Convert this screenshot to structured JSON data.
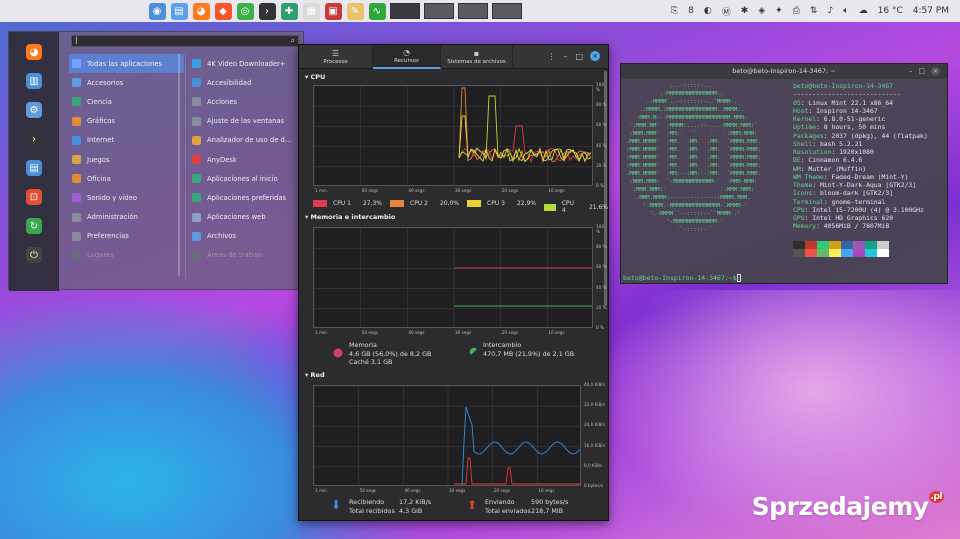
{
  "panel": {
    "launchers": [
      {
        "name": "mint-menu-icon",
        "color": "#4a90d9",
        "glyph": "◉"
      },
      {
        "name": "files-icon",
        "color": "#5fa0e6",
        "glyph": "▤"
      },
      {
        "name": "firefox-icon",
        "color": "#ff7a1a",
        "glyph": "◕"
      },
      {
        "name": "brave-icon",
        "color": "#fb542b",
        "glyph": "◆"
      },
      {
        "name": "chrome-icon",
        "color": "#3bb04b",
        "glyph": "◎"
      },
      {
        "name": "terminal-icon",
        "color": "#333333",
        "glyph": "›"
      },
      {
        "name": "update-icon",
        "color": "#2e9e6e",
        "glyph": "✚"
      },
      {
        "name": "calculator-icon",
        "color": "#d9d9d9",
        "glyph": "▦"
      },
      {
        "name": "screenshot-icon",
        "color": "#c83b3b",
        "glyph": "▣"
      },
      {
        "name": "text-editor-icon",
        "color": "#e8c36a",
        "glyph": "✎"
      },
      {
        "name": "system-monitor-icon",
        "color": "#2fa83a",
        "glyph": "∿"
      }
    ],
    "tray": {
      "badge": "8",
      "temperature": "16 °C",
      "time": "4:57 PM"
    }
  },
  "menu": {
    "search_value": "|",
    "categories": [
      {
        "label": "Todas las aplicaciones",
        "color": "#6fa3ff"
      },
      {
        "label": "Accesorios",
        "color": "#5f9be0"
      },
      {
        "label": "Ciencia",
        "color": "#3aa87a"
      },
      {
        "label": "Gráficos",
        "color": "#e08a3a"
      },
      {
        "label": "Internet",
        "color": "#4a90d9"
      },
      {
        "label": "Juegos",
        "color": "#d9a24a"
      },
      {
        "label": "Oficina",
        "color": "#e08a3a"
      },
      {
        "label": "Sonido y vídeo",
        "color": "#a060d0"
      },
      {
        "label": "Administración",
        "color": "#8a8aa0"
      },
      {
        "label": "Preferencias",
        "color": "#8a8aa0"
      },
      {
        "label": "Lugares",
        "color": "#6a6a80"
      }
    ],
    "apps": [
      {
        "label": "4K Video Downloader+",
        "color": "#3aa0e0"
      },
      {
        "label": "Accesibilidad",
        "color": "#4a90d9"
      },
      {
        "label": "Acciones",
        "color": "#8a8aa0"
      },
      {
        "label": "Ajuste de las ventanas",
        "color": "#8a8aa0"
      },
      {
        "label": "Analizador de uso de d...",
        "color": "#e0a040"
      },
      {
        "label": "AnyDesk",
        "color": "#e04040"
      },
      {
        "label": "Aplicaciones al inicio",
        "color": "#3aa87a"
      },
      {
        "label": "Aplicaciones preferidas",
        "color": "#3aa87a"
      },
      {
        "label": "Aplicaciones web",
        "color": "#8aa0c0"
      },
      {
        "label": "Archivos",
        "color": "#5f9be0"
      },
      {
        "label": "Áreas de trabajo",
        "color": "#6a6a80"
      }
    ],
    "favorites": [
      {
        "name": "firefox-fav-icon",
        "color": "#ff7a1a",
        "glyph": "◕"
      },
      {
        "name": "software-manager-fav-icon",
        "color": "#4a90d9",
        "glyph": "▥"
      },
      {
        "name": "settings-fav-icon",
        "color": "#5f9be0",
        "glyph": "⚙"
      },
      {
        "name": "terminal-fav-icon",
        "color": "#333333",
        "glyph": "›"
      },
      {
        "name": "files-fav-icon",
        "color": "#4a90d9",
        "glyph": "▤"
      },
      {
        "name": "lock-fav-icon",
        "color": "#e05030",
        "glyph": "⊡"
      },
      {
        "name": "logout-fav-icon",
        "color": "#3aa850",
        "glyph": "↻"
      },
      {
        "name": "power-fav-icon",
        "color": "#444444",
        "glyph": "⏻"
      }
    ]
  },
  "sysmon": {
    "tabs": [
      {
        "label": "Procesos",
        "glyph": "☰"
      },
      {
        "label": "Recursos",
        "glyph": "◔"
      },
      {
        "label": "Sistemas de archivos",
        "glyph": "▪"
      }
    ],
    "cpu_title": "CPU",
    "mem_title": "Memoria e intercambio",
    "net_title": "Red",
    "x_ticks": [
      "1 min",
      "50 segs",
      "40 segs",
      "30 segs",
      "20 segs",
      "10 segs"
    ],
    "pct_ticks": [
      "100 %",
      "80 %",
      "60 %",
      "40 %",
      "20 %",
      "0 %"
    ],
    "net_ticks": [
      "40,0 KiB/s",
      "32,0 KiB/s",
      "24,0 KiB/s",
      "16,0 KiB/s",
      "8,0 KiB/s",
      "0 bytes/s"
    ],
    "cpu_legend": [
      {
        "label": "CPU 1",
        "pct": "27,3%",
        "color": "#e0384e"
      },
      {
        "label": "CPU 2",
        "pct": "20,0%",
        "color": "#e8843a"
      },
      {
        "label": "CPU 3",
        "pct": "22,9%",
        "color": "#e8d23a"
      },
      {
        "label": "CPU 4",
        "pct": "21,6%",
        "color": "#b6dc3a"
      }
    ],
    "memory": {
      "label": "Memoria",
      "value": "4,6 GB (56,0%) de 8,2 GB",
      "cache": "Caché 3,1 GB",
      "color": "#d04070"
    },
    "swap": {
      "label": "Intercambio",
      "value": "470,7 MB (21,9%) de 2,1 GB",
      "color": "#46b060"
    },
    "receiving": {
      "label": "Recibiendo",
      "total_label": "Total recibidos",
      "rate": "17,2 KiB/s",
      "total": "4,3 GiB",
      "color": "#3a8ee0"
    },
    "sending": {
      "label": "Enviando",
      "total_label": "Total enviados",
      "rate": "590 bytes/s",
      "total": "218,7 MiB",
      "color": "#e04030"
    }
  },
  "terminal": {
    "title": "beto@beto-Inspiron-14-3467: ~",
    "user_host": "beto@beto-Inspiron-14-3467",
    "separator": "----------------------------",
    "info": [
      {
        "k": "OS",
        "v": "Linux Mint 22.1 x86_64"
      },
      {
        "k": "Host",
        "v": "Inspiron 14-3467"
      },
      {
        "k": "Kernel",
        "v": "6.8.0-51-generic"
      },
      {
        "k": "Uptime",
        "v": "8 hours, 50 mins"
      },
      {
        "k": "Packages",
        "v": "2037 (dpkg), 44 (flatpak)"
      },
      {
        "k": "Shell",
        "v": "bash 5.2.21"
      },
      {
        "k": "Resolution",
        "v": "1920x1080"
      },
      {
        "k": "DE",
        "v": "Cinnamon 6.4.6"
      },
      {
        "k": "WM",
        "v": "Mutter (Muffin)"
      },
      {
        "k": "WM Theme",
        "v": "Faded-Dream (Mint-Y)"
      },
      {
        "k": "Theme",
        "v": "Mint-Y-Dark-Aqua [GTK2/3]"
      },
      {
        "k": "Icons",
        "v": "bloom-dark [GTK2/3]"
      },
      {
        "k": "Terminal",
        "v": "gnome-terminal"
      },
      {
        "k": "CPU",
        "v": "Intel i5-7200U (4) @ 3.100GHz"
      },
      {
        "k": "GPU",
        "v": "Intel HD Graphics 620"
      },
      {
        "k": "Memory",
        "v": "4056MiB / 7807MiB"
      }
    ],
    "palette": [
      "#2e2e2e",
      "#c0392b",
      "#2ecc71",
      "#d4a017",
      "#3465a4",
      "#9b59b6",
      "#16a085",
      "#cccccc",
      "#555555",
      "#ef5350",
      "#66bb6a",
      "#ffee58",
      "#42a5f5",
      "#ab47bc",
      "#26c6da",
      "#ffffff"
    ],
    "prompt": "beto@beto-Inspiron-14-3467:~$"
  },
  "watermark": {
    "text": "Sprzedajemy",
    "tld": ".pl"
  }
}
